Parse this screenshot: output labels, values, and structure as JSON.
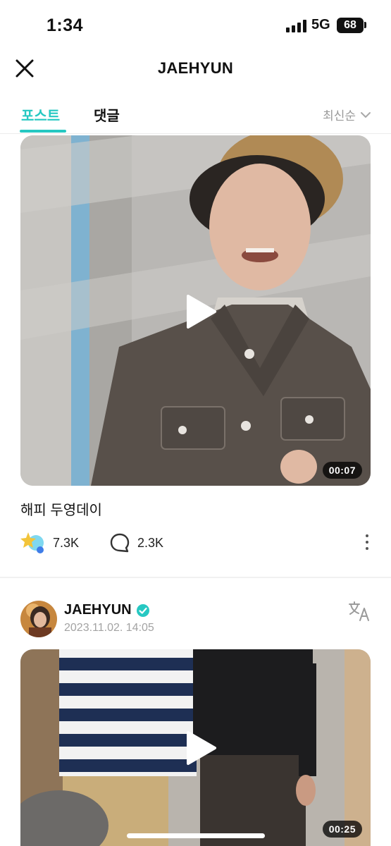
{
  "status_bar": {
    "time": "1:34",
    "network": "5G",
    "battery": "68"
  },
  "header": {
    "title": "JAEHYUN",
    "close_icon": "close-icon"
  },
  "tabs": [
    {
      "label": "포스트",
      "active": true
    },
    {
      "label": "댓글",
      "active": false
    }
  ],
  "sort": {
    "label": "최신순"
  },
  "posts": [
    {
      "duration": "00:07",
      "caption": "해피 두영데이",
      "likes": "7.3K",
      "comments": "2.3K"
    },
    {
      "author": "JAEHYUN",
      "timestamp": "2023.11.02. 14:05",
      "duration": "00:25"
    }
  ],
  "colors": {
    "accent": "#26c8c2",
    "verified": "#26c8c2"
  }
}
